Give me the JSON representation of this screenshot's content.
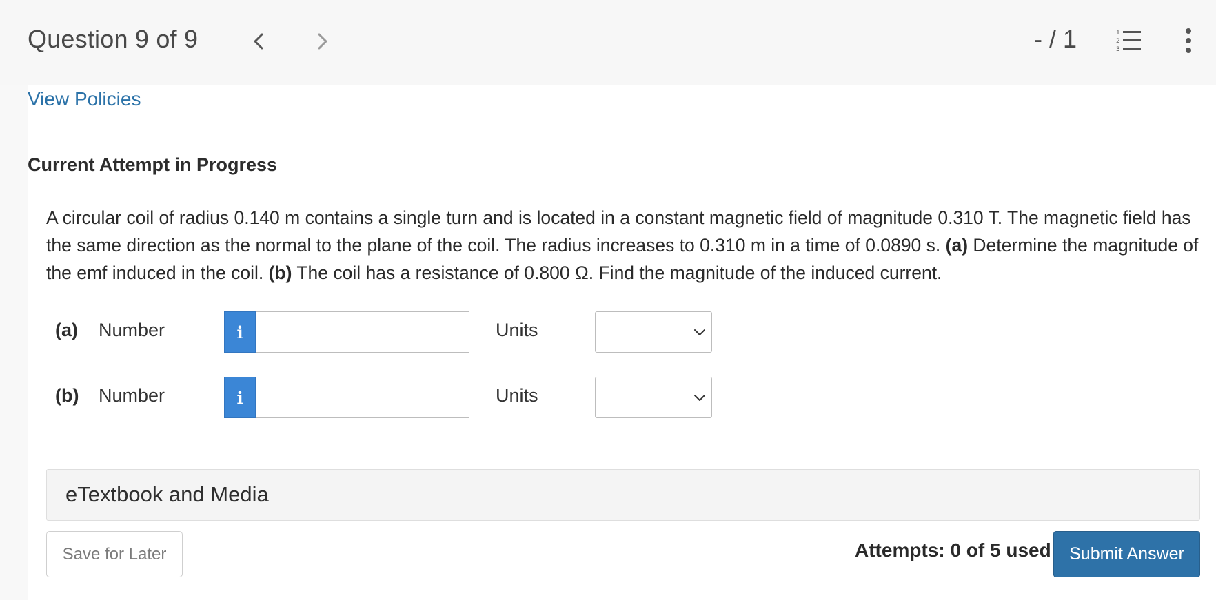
{
  "header": {
    "question_title": "Question 9 of 9",
    "score": "- / 1",
    "icons": {
      "prev": "chevron-left-icon",
      "next": "chevron-right-icon",
      "list": "numbered-list-icon",
      "more": "more-vertical-icon"
    }
  },
  "links": {
    "view_policies": "View Policies"
  },
  "attempt": {
    "heading": "Current Attempt in Progress"
  },
  "problem": {
    "segments": [
      {
        "text": "A circular coil of radius 0.140 m contains a single turn and is located in a constant magnetic field of magnitude 0.310 T. The magnetic field has the same direction as the normal to the plane of the coil. The radius increases to 0.310 m in a time of 0.0890 s. ",
        "bold": false
      },
      {
        "text": "(a)",
        "bold": true
      },
      {
        "text": " Determine the magnitude of the emf induced in the coil. ",
        "bold": false
      },
      {
        "text": "(b)",
        "bold": true
      },
      {
        "text": " The coil has a resistance of 0.800 Ω. Find the magnitude of the induced current.",
        "bold": false
      }
    ]
  },
  "parts": [
    {
      "label": "(a)",
      "number_label": "Number",
      "number_value": "",
      "units_label": "Units",
      "units_value": ""
    },
    {
      "label": "(b)",
      "number_label": "Number",
      "number_value": "",
      "units_label": "Units",
      "units_value": ""
    }
  ],
  "media": {
    "label": "eTextbook and Media"
  },
  "footer": {
    "save_label": "Save for Later",
    "attempts_text": "Attempts: 0 of 5 used",
    "submit_label": "Submit Answer"
  },
  "colors": {
    "link": "#2b72a8",
    "info_button": "#3b86d6",
    "submit_button": "#2e72a8",
    "header_bg": "#f7f7f7"
  }
}
